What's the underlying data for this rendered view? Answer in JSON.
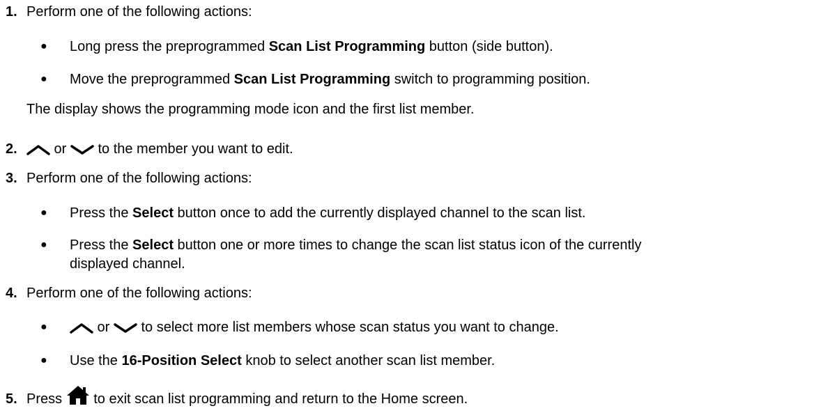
{
  "steps": {
    "s1": {
      "num": "1.",
      "text": "Perform one of the following actions:",
      "b1": {
        "pre": "Long press the preprogrammed ",
        "bold": "Scan List Programming",
        "post": " button (side button)."
      },
      "b2": {
        "pre": "Move the preprogrammed ",
        "bold": "Scan List Programming",
        "post": " switch to programming position."
      },
      "result": "The display shows the programming mode icon and the first list member."
    },
    "s2": {
      "num": "2.",
      "or": " or ",
      "post": " to the member you want to edit."
    },
    "s3": {
      "num": "3.",
      "text": "Perform one of the following actions:",
      "b1": {
        "pre": "Press the ",
        "bold": "Select",
        "post": " button once to add the currently displayed channel to the scan list."
      },
      "b2": {
        "pre": "Press the ",
        "bold": "Select",
        "post": " button one or more times to change the scan list status icon of the currently",
        "cont": "displayed channel."
      }
    },
    "s4": {
      "num": "4.",
      "text": "Perform one of the following actions:",
      "b1": {
        "or": " or ",
        "post": " to select more list members whose scan status you want to change."
      },
      "b2": {
        "pre": "Use the ",
        "bold": "16-Position Select",
        "post": " knob to select another scan list member."
      }
    },
    "s5": {
      "num": "5.",
      "pre": "Press ",
      "post": " to exit scan list programming and return to the Home screen."
    }
  },
  "bullet_char": "●",
  "icons": {
    "up": "chevron-up-icon",
    "down": "chevron-down-icon",
    "home": "home-icon"
  }
}
